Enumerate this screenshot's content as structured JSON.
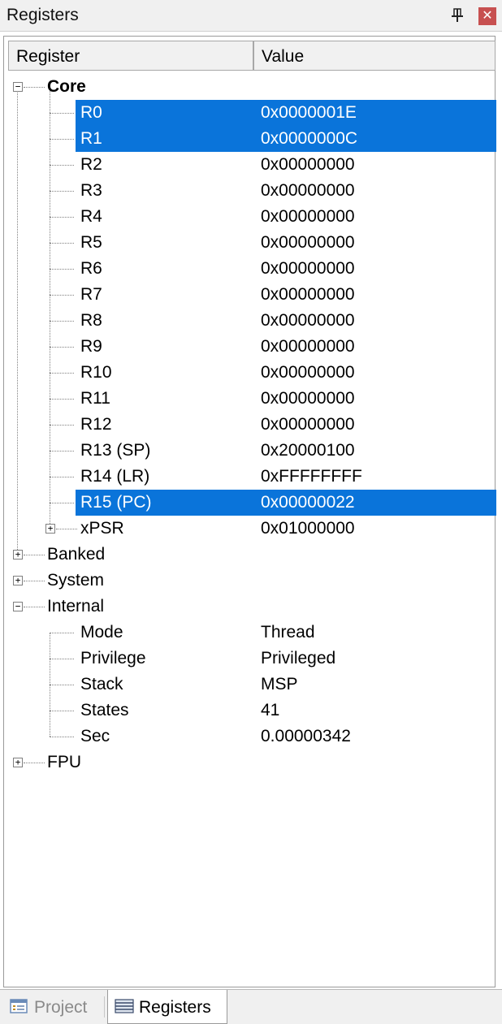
{
  "window": {
    "title": "Registers",
    "pin_icon": "pin-icon",
    "close_icon": "close-icon",
    "close_glyph": "✕"
  },
  "columns": {
    "register": "Register",
    "value": "Value"
  },
  "tree": {
    "core": {
      "label": "Core",
      "expanded": true,
      "rows": [
        {
          "name": "R0",
          "value": "0x0000001E",
          "selected": true
        },
        {
          "name": "R1",
          "value": "0x0000000C",
          "selected": true
        },
        {
          "name": "R2",
          "value": "0x00000000"
        },
        {
          "name": "R3",
          "value": "0x00000000"
        },
        {
          "name": "R4",
          "value": "0x00000000"
        },
        {
          "name": "R5",
          "value": "0x00000000"
        },
        {
          "name": "R6",
          "value": "0x00000000"
        },
        {
          "name": "R7",
          "value": "0x00000000"
        },
        {
          "name": "R8",
          "value": "0x00000000"
        },
        {
          "name": "R9",
          "value": "0x00000000"
        },
        {
          "name": "R10",
          "value": "0x00000000"
        },
        {
          "name": "R11",
          "value": "0x00000000"
        },
        {
          "name": "R12",
          "value": "0x00000000"
        },
        {
          "name": "R13 (SP)",
          "value": "0x20000100"
        },
        {
          "name": "R14 (LR)",
          "value": "0xFFFFFFFF"
        },
        {
          "name": "R15 (PC)",
          "value": "0x00000022",
          "selected": true
        },
        {
          "name": "xPSR",
          "value": "0x01000000",
          "expandable": true
        }
      ]
    },
    "banked": {
      "label": "Banked"
    },
    "system": {
      "label": "System"
    },
    "internal": {
      "label": "Internal",
      "expanded": true,
      "rows": [
        {
          "name": "Mode",
          "value": "Thread"
        },
        {
          "name": "Privilege",
          "value": "Privileged"
        },
        {
          "name": "Stack",
          "value": "MSP"
        },
        {
          "name": "States",
          "value": "41"
        },
        {
          "name": "Sec",
          "value": "0.00000342"
        }
      ]
    },
    "fpu": {
      "label": "FPU"
    }
  },
  "tabs": [
    {
      "label": "Project",
      "icon": "project-icon",
      "active": false
    },
    {
      "label": "Registers",
      "icon": "registers-icon",
      "active": true
    }
  ],
  "colors": {
    "selection": "#0A74DA",
    "close": "#C75050"
  }
}
